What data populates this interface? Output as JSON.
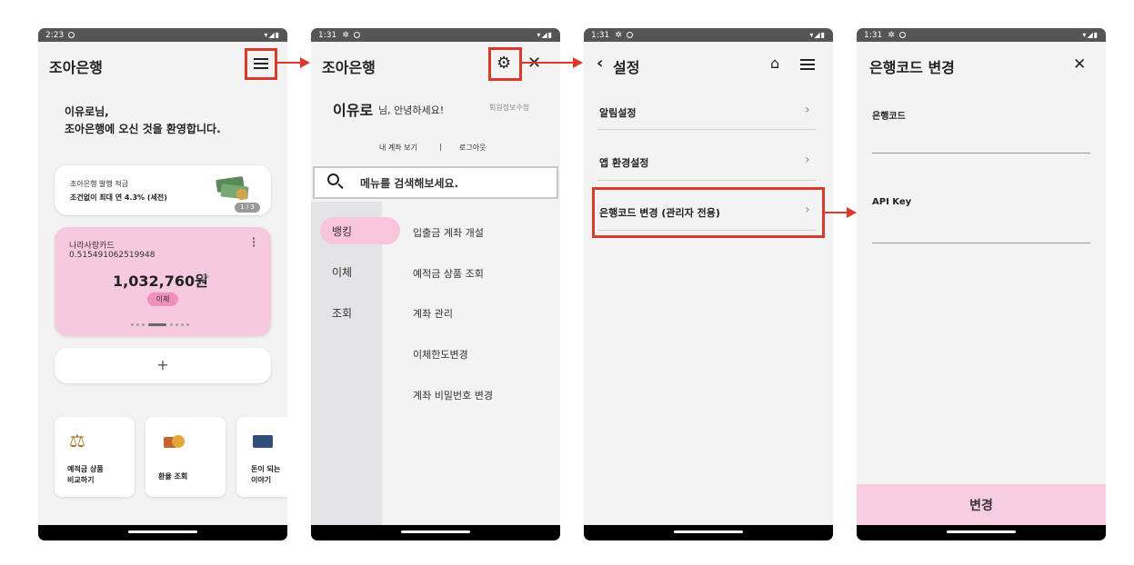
{
  "screen1": {
    "time": "2:23",
    "app_title": "조아은행",
    "greeting_line1": "이유로님,",
    "greeting_line2": "조아은행에 오신 것을 환영합니다.",
    "promo": {
      "title": "조아은행 발행 적금",
      "subtitle": "조건없이 최대 연 4.3% (세전)",
      "page": "1 / 3"
    },
    "account": {
      "name": "나라사랑카드",
      "number": "0.515491062519948",
      "balance": "1,032,760원",
      "transfer": "이체"
    },
    "add_label": "+",
    "shortcuts": [
      {
        "line1": "예적금 상품",
        "line2": "비교하기"
      },
      {
        "line1": "환율 조회",
        "line2": ""
      },
      {
        "line1": "돈이 되는",
        "line2": "이야기"
      }
    ]
  },
  "screen2": {
    "time": "1:31",
    "app_title": "조아은행",
    "user_name": "이유로",
    "user_greet": "님, 안녕하세요!",
    "edit_profile": "회원정보수정",
    "my_account": "내 계좌 보기",
    "separator": "|",
    "logout": "로그아웃",
    "search_placeholder": "메뉴를 검색해보세요.",
    "categories": [
      "뱅킹",
      "이체",
      "조회"
    ],
    "items": [
      "입출금 계좌 개설",
      "예적금 상품 조회",
      "계좌 관리",
      "이체한도변경",
      "계좌 비밀번호 변경"
    ]
  },
  "screen3": {
    "time": "1:31",
    "title": "설정",
    "rows": [
      "알림설정",
      "앱 환경설정",
      "은행코드 변경 (관리자 전용)"
    ]
  },
  "screen4": {
    "time": "1:31",
    "title": "은행코드 변경",
    "field1_label": "은행코드",
    "field2_label": "API Key",
    "submit": "변경"
  },
  "colors": {
    "highlight": "#d93a2b",
    "pink": "#f7c9de",
    "pink_button": "#f8cde2"
  }
}
